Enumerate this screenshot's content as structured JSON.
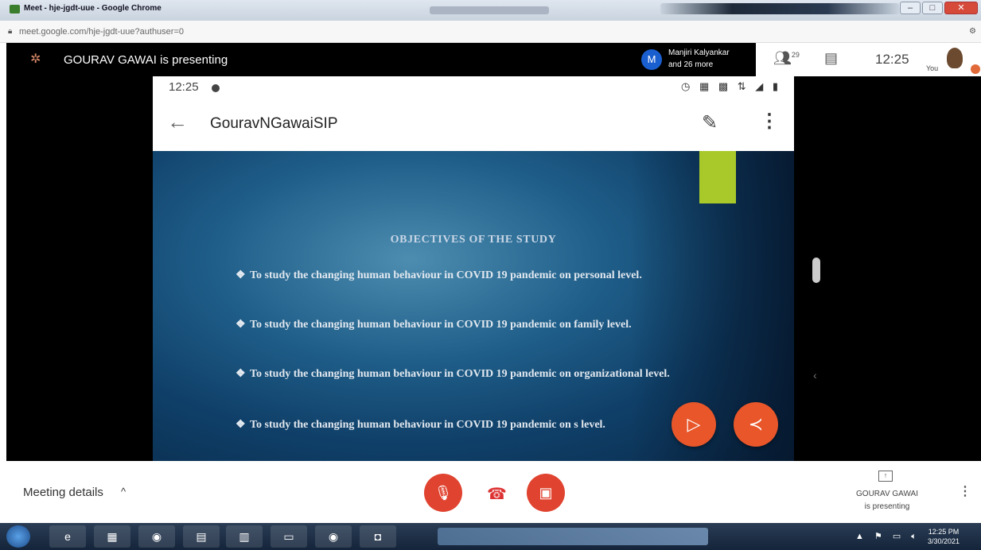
{
  "browser": {
    "window_title": "Meet - hje-jgdt-uue - Google Chrome",
    "url": "meet.google.com/hje-jgdt-uue?authuser=0",
    "buttons": {
      "minimize": "–",
      "maximize": "□",
      "close": "✕"
    }
  },
  "meet_header": {
    "presenter_text": "GOURAV GAWAI is presenting",
    "participant_avatar_letter": "M",
    "participant_name": "Manjiri Kalyankar",
    "participant_more": "and 26 more",
    "people_count": "29",
    "clock": "12:25",
    "you_label": "You"
  },
  "phone": {
    "status_time": "12:25",
    "status_icons": "◷ ▦ ▩ ⇅ ◢ ▮",
    "app_title": "GouravNGawaiSIP"
  },
  "slide": {
    "heading": "OBJECTIVES OF THE STUDY",
    "bullet_symbol": "❖",
    "objectives": [
      "To study the changing human behaviour in COVID 19 pandemic on personal level.",
      "To study the changing human behaviour in COVID 19 pandemic on family level.",
      "To study the changing human behaviour in COVID 19 pandemic on organizational level.",
      "To study the changing human behaviour in COVID 19 pandemic on s level."
    ]
  },
  "bottom_bar": {
    "meeting_details": "Meeting details",
    "presenter_name": "GOURAV GAWAI",
    "presenter_status": "is presenting"
  },
  "taskbar": {
    "time": "12:25 PM",
    "date": "3/30/2021"
  },
  "colors": {
    "accent_red": "#e0432f",
    "fab_orange": "#e8562a",
    "slide_blue": "#1f5f8a",
    "slide_green": "#a9c92a"
  }
}
